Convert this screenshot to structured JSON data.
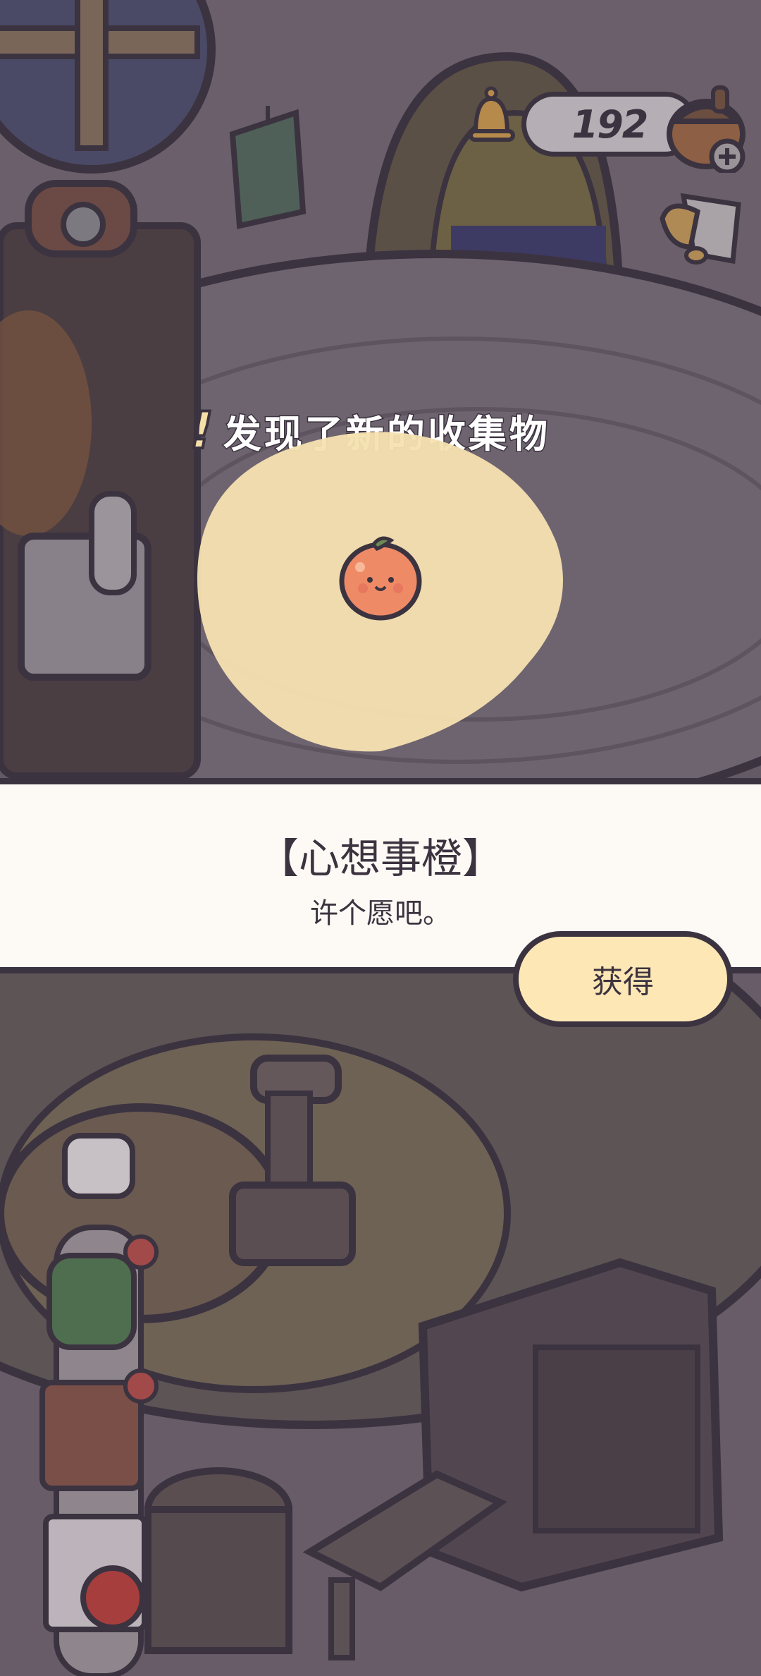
{
  "hud": {
    "acorn_count": "192",
    "icons": [
      "bell-icon",
      "acorn-add-icon",
      "cup-icon"
    ]
  },
  "notification": {
    "exclamation": "!",
    "text": "发现了新的收集物"
  },
  "item": {
    "icon": "tangerine-icon",
    "name": "【心想事橙】",
    "description": "许个愿吧。"
  },
  "actions": {
    "obtain_label": "获得"
  },
  "colors": {
    "outline": "#3c3340",
    "panel_bg": "#fdfaf5",
    "button_bg": "#fde8b5",
    "highlight_blob": "#f6e2b0",
    "tangerine": "#ee8a66"
  }
}
